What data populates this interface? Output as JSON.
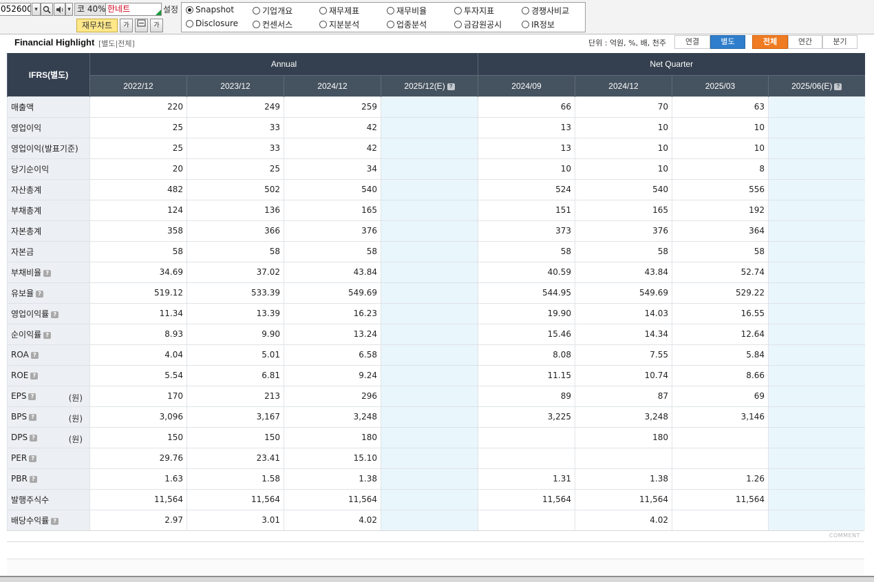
{
  "toolbar": {
    "stock_code": "052600",
    "code_label": "코 40%",
    "company_name": "한네트",
    "setting_label": "설정",
    "chart_button": "재무차트",
    "font_btn": "가",
    "font_btn2": "가"
  },
  "radio_options": [
    {
      "label": "Snapshot",
      "selected": true
    },
    {
      "label": "기업개요",
      "selected": false
    },
    {
      "label": "재무제표",
      "selected": false
    },
    {
      "label": "재무비율",
      "selected": false
    },
    {
      "label": "투자지표",
      "selected": false
    },
    {
      "label": "경쟁사비교",
      "selected": false
    },
    {
      "label": "Disclosure",
      "selected": false
    },
    {
      "label": "컨센서스",
      "selected": false
    },
    {
      "label": "지분분석",
      "selected": false
    },
    {
      "label": "업종분석",
      "selected": false
    },
    {
      "label": "금감원공시",
      "selected": false
    },
    {
      "label": "IR정보",
      "selected": false
    }
  ],
  "section": {
    "title": "Financial Highlight",
    "subtitle": "[별도|전체]",
    "unit_text": "단위 : 억원, %, 배, 천주",
    "tabs": {
      "consolidated": "연결",
      "separate": "별도",
      "all": "전체",
      "annual": "연간",
      "quarter": "분기"
    }
  },
  "table": {
    "corner_label": "IFRS(별도)",
    "group_annual": "Annual",
    "group_quarter": "Net Quarter",
    "columns": [
      "2022/12",
      "2023/12",
      "2024/12",
      "2025/12(E)",
      "2024/09",
      "2024/12",
      "2025/03",
      "2025/06(E)"
    ],
    "rows": [
      {
        "label": "매출액",
        "help": false,
        "unit": "",
        "values": [
          "220",
          "249",
          "259",
          "",
          "66",
          "70",
          "63",
          ""
        ]
      },
      {
        "label": "영업이익",
        "help": false,
        "unit": "",
        "values": [
          "25",
          "33",
          "42",
          "",
          "13",
          "10",
          "10",
          ""
        ]
      },
      {
        "label": "영업이익(발표기준)",
        "help": false,
        "unit": "",
        "values": [
          "25",
          "33",
          "42",
          "",
          "13",
          "10",
          "10",
          ""
        ]
      },
      {
        "label": "당기순이익",
        "help": false,
        "unit": "",
        "values": [
          "20",
          "25",
          "34",
          "",
          "10",
          "10",
          "8",
          ""
        ]
      },
      {
        "label": "자산총계",
        "help": false,
        "unit": "",
        "values": [
          "482",
          "502",
          "540",
          "",
          "524",
          "540",
          "556",
          ""
        ]
      },
      {
        "label": "부채총계",
        "help": false,
        "unit": "",
        "values": [
          "124",
          "136",
          "165",
          "",
          "151",
          "165",
          "192",
          ""
        ]
      },
      {
        "label": "자본총계",
        "help": false,
        "unit": "",
        "values": [
          "358",
          "366",
          "376",
          "",
          "373",
          "376",
          "364",
          ""
        ]
      },
      {
        "label": "자본금",
        "help": false,
        "unit": "",
        "values": [
          "58",
          "58",
          "58",
          "",
          "58",
          "58",
          "58",
          ""
        ]
      },
      {
        "label": "부채비율",
        "help": true,
        "unit": "",
        "values": [
          "34.69",
          "37.02",
          "43.84",
          "",
          "40.59",
          "43.84",
          "52.74",
          ""
        ]
      },
      {
        "label": "유보율",
        "help": true,
        "unit": "",
        "values": [
          "519.12",
          "533.39",
          "549.69",
          "",
          "544.95",
          "549.69",
          "529.22",
          ""
        ]
      },
      {
        "label": "영업이익률",
        "help": true,
        "unit": "",
        "values": [
          "11.34",
          "13.39",
          "16.23",
          "",
          "19.90",
          "14.03",
          "16.55",
          ""
        ]
      },
      {
        "label": "순이익률",
        "help": true,
        "unit": "",
        "values": [
          "8.93",
          "9.90",
          "13.24",
          "",
          "15.46",
          "14.34",
          "12.64",
          ""
        ]
      },
      {
        "label": "ROA",
        "help": true,
        "unit": "",
        "values": [
          "4.04",
          "5.01",
          "6.58",
          "",
          "8.08",
          "7.55",
          "5.84",
          ""
        ]
      },
      {
        "label": "ROE",
        "help": true,
        "unit": "",
        "values": [
          "5.54",
          "6.81",
          "9.24",
          "",
          "11.15",
          "10.74",
          "8.66",
          ""
        ]
      },
      {
        "label": "EPS",
        "help": true,
        "unit": "(원)",
        "values": [
          "170",
          "213",
          "296",
          "",
          "89",
          "87",
          "69",
          ""
        ]
      },
      {
        "label": "BPS",
        "help": true,
        "unit": "(원)",
        "values": [
          "3,096",
          "3,167",
          "3,248",
          "",
          "3,225",
          "3,248",
          "3,146",
          ""
        ]
      },
      {
        "label": "DPS",
        "help": true,
        "unit": "(원)",
        "values": [
          "150",
          "150",
          "180",
          "",
          "",
          "180",
          "",
          ""
        ]
      },
      {
        "label": "PER",
        "help": true,
        "unit": "",
        "values": [
          "29.76",
          "23.41",
          "15.10",
          "",
          "",
          "",
          "",
          ""
        ]
      },
      {
        "label": "PBR",
        "help": true,
        "unit": "",
        "values": [
          "1.63",
          "1.58",
          "1.38",
          "",
          "1.31",
          "1.38",
          "1.26",
          ""
        ]
      },
      {
        "label": "발행주식수",
        "help": false,
        "unit": "",
        "values": [
          "11,564",
          "11,564",
          "11,564",
          "",
          "11,564",
          "11,564",
          "11,564",
          ""
        ]
      },
      {
        "label": "배당수익률",
        "help": true,
        "unit": "",
        "values": [
          "2.97",
          "3.01",
          "4.02",
          "",
          "",
          "4.02",
          "",
          ""
        ]
      }
    ]
  },
  "footer": {
    "comment_label": "COMMENT"
  },
  "colors": {
    "header_dark": "#34404f",
    "header_mid": "#45525f",
    "accent_blue": "#2f7ecb",
    "accent_orange": "#ef7b22",
    "estimate_bg": "#e9f6fb",
    "label_bg": "#eceff3"
  }
}
